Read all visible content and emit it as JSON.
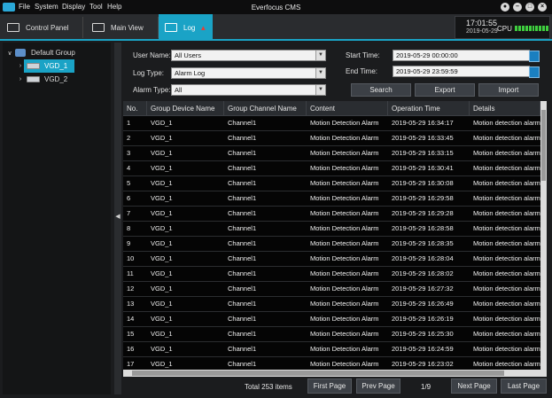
{
  "menubar": {
    "items": [
      "File",
      "System",
      "Display",
      "Tool",
      "Help"
    ],
    "title": "Everfocus CMS",
    "window_buttons": [
      "lock-icon",
      "minimize-icon",
      "restore-icon",
      "close-icon"
    ]
  },
  "tabs": [
    {
      "label": "Control Panel",
      "icon": "keyboard-icon"
    },
    {
      "label": "Main View",
      "icon": "monitor-icon"
    },
    {
      "label": "Log",
      "icon": "log-icon",
      "active": true
    }
  ],
  "status": {
    "time": "17:01:55",
    "date": "2019-05-29",
    "cpu_label": "CPU"
  },
  "tree": {
    "root": "Default Group",
    "devices": [
      "VGD_1",
      "VGD_2"
    ],
    "selected": "VGD_1"
  },
  "filter": {
    "user_name_label": "User Name:",
    "user_name_value": "All Users",
    "log_type_label": "Log Type:",
    "log_type_value": "Alarm Log",
    "alarm_type_label": "Alarm Type:",
    "alarm_type_value": "All",
    "start_time_label": "Start Time:",
    "start_time_value": "2019-05-29 00:00:00",
    "end_time_label": "End Time:",
    "end_time_value": "2019-05-29 23:59:59",
    "search_label": "Search",
    "export_label": "Export",
    "import_label": "Import"
  },
  "table": {
    "columns": [
      "No.",
      "Group Device Name",
      "Group Channel Name",
      "Content",
      "Operation Time",
      "Details"
    ],
    "rows": [
      [
        "1",
        "VGD_1",
        "Channel1",
        "Motion Detection Alarm",
        "2019-05-29 16:34:17",
        "Motion detection alarm"
      ],
      [
        "2",
        "VGD_1",
        "Channel1",
        "Motion Detection Alarm",
        "2019-05-29 16:33:45",
        "Motion detection alarm"
      ],
      [
        "3",
        "VGD_1",
        "Channel1",
        "Motion Detection Alarm",
        "2019-05-29 16:33:15",
        "Motion detection alarm"
      ],
      [
        "4",
        "VGD_1",
        "Channel1",
        "Motion Detection Alarm",
        "2019-05-29 16:30:41",
        "Motion detection alarm"
      ],
      [
        "5",
        "VGD_1",
        "Channel1",
        "Motion Detection Alarm",
        "2019-05-29 16:30:08",
        "Motion detection alarm"
      ],
      [
        "6",
        "VGD_1",
        "Channel1",
        "Motion Detection Alarm",
        "2019-05-29 16:29:58",
        "Motion detection alarm"
      ],
      [
        "7",
        "VGD_1",
        "Channel1",
        "Motion Detection Alarm",
        "2019-05-29 16:29:28",
        "Motion detection alarm"
      ],
      [
        "8",
        "VGD_1",
        "Channel1",
        "Motion Detection Alarm",
        "2019-05-29 16:28:58",
        "Motion detection alarm"
      ],
      [
        "9",
        "VGD_1",
        "Channel1",
        "Motion Detection Alarm",
        "2019-05-29 16:28:35",
        "Motion detection alarm"
      ],
      [
        "10",
        "VGD_1",
        "Channel1",
        "Motion Detection Alarm",
        "2019-05-29 16:28:04",
        "Motion detection alarm"
      ],
      [
        "11",
        "VGD_1",
        "Channel1",
        "Motion Detection Alarm",
        "2019-05-29 16:28:02",
        "Motion detection alarm"
      ],
      [
        "12",
        "VGD_1",
        "Channel1",
        "Motion Detection Alarm",
        "2019-05-29 16:27:32",
        "Motion detection alarm"
      ],
      [
        "13",
        "VGD_1",
        "Channel1",
        "Motion Detection Alarm",
        "2019-05-29 16:26:49",
        "Motion detection alarm"
      ],
      [
        "14",
        "VGD_1",
        "Channel1",
        "Motion Detection Alarm",
        "2019-05-29 16:26:19",
        "Motion detection alarm"
      ],
      [
        "15",
        "VGD_1",
        "Channel1",
        "Motion Detection Alarm",
        "2019-05-29 16:25:30",
        "Motion detection alarm"
      ],
      [
        "16",
        "VGD_1",
        "Channel1",
        "Motion Detection Alarm",
        "2019-05-29 16:24:59",
        "Motion detection alarm"
      ],
      [
        "17",
        "VGD_1",
        "Channel1",
        "Motion Detection Alarm",
        "2019-05-29 16:23:02",
        "Motion detection alarm"
      ]
    ]
  },
  "footer": {
    "total": "Total 253 items",
    "first_page": "First Page",
    "prev_page": "Prev Page",
    "page_indicator": "1/9",
    "next_page": "Next Page",
    "last_page": "Last Page"
  },
  "colors": {
    "accent": "#1aa3c6",
    "cpu_meter": "#3fcf3f",
    "log_alert": "#e0403a"
  }
}
